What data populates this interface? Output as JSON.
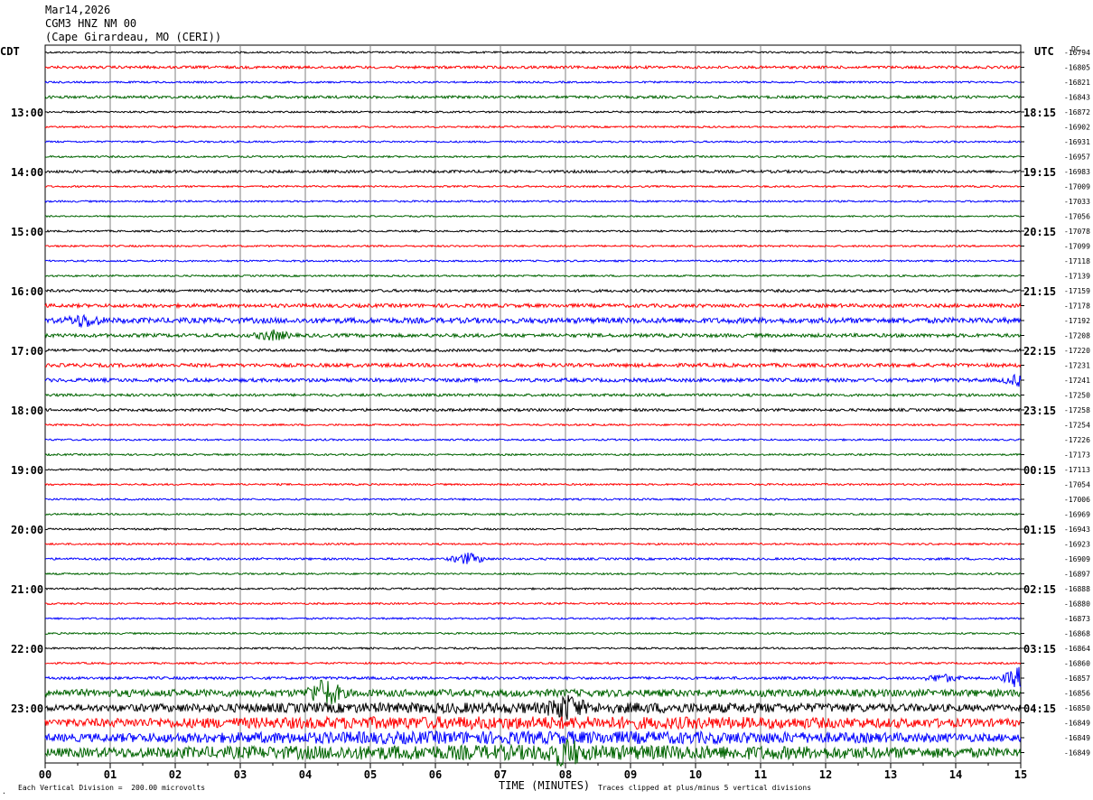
{
  "header": {
    "date": "Mar14,2026",
    "station": "CGM3 HNZ NM 00",
    "location": "(Cape Girardeau, MO (CERI))",
    "left_tz": "CDT",
    "right_tz": "UTC",
    "dc_label": "DC"
  },
  "footer": {
    "division_note": "Each Vertical Division =  200.00 microvolts",
    "x_title": "TIME (MINUTES)",
    "clip_note": "Traces clipped at plus/minus 5 vertical divisions"
  },
  "colors": {
    "black": "#000000",
    "red": "#ff0000",
    "blue": "#0000ff",
    "green": "#006400",
    "grid": "#808080"
  },
  "chart_data": {
    "type": "line",
    "title": "CGM3 HNZ NM 00",
    "xlabel": "TIME (MINUTES)",
    "xlim": [
      0,
      15
    ],
    "x_ticks": [
      "00",
      "01",
      "02",
      "03",
      "04",
      "05",
      "06",
      "07",
      "08",
      "09",
      "10",
      "11",
      "12",
      "13",
      "14",
      "15"
    ],
    "left_hour_labels": [
      {
        "row": 4,
        "label": "13:00"
      },
      {
        "row": 8,
        "label": "14:00"
      },
      {
        "row": 12,
        "label": "15:00"
      },
      {
        "row": 16,
        "label": "16:00"
      },
      {
        "row": 20,
        "label": "17:00"
      },
      {
        "row": 24,
        "label": "18:00"
      },
      {
        "row": 28,
        "label": "19:00"
      },
      {
        "row": 32,
        "label": "20:00"
      },
      {
        "row": 36,
        "label": "21:00"
      },
      {
        "row": 40,
        "label": "22:00"
      },
      {
        "row": 44,
        "label": "23:00"
      }
    ],
    "right_hour_labels": [
      {
        "row": 4,
        "label": "18:15"
      },
      {
        "row": 8,
        "label": "19:15"
      },
      {
        "row": 12,
        "label": "20:15"
      },
      {
        "row": 16,
        "label": "21:15"
      },
      {
        "row": 20,
        "label": "22:15"
      },
      {
        "row": 24,
        "label": "23:15"
      },
      {
        "row": 28,
        "label": "00:15"
      },
      {
        "row": 32,
        "label": "01:15"
      },
      {
        "row": 36,
        "label": "02:15"
      },
      {
        "row": 40,
        "label": "03:15"
      },
      {
        "row": 44,
        "label": "04:15"
      }
    ],
    "dc_offsets": [
      "-16794",
      "-16805",
      "-16821",
      "-16843",
      "-16872",
      "-16902",
      "-16931",
      "-16957",
      "-16983",
      "-17009",
      "-17033",
      "-17056",
      "-17078",
      "-17099",
      "-17118",
      "-17139",
      "-17159",
      "-17178",
      "-17192",
      "-17208",
      "-17220",
      "-17231",
      "-17241",
      "-17250",
      "-17258",
      "-17254",
      "-17226",
      "-17173",
      "-17113",
      "-17054",
      "-17006",
      "-16969",
      "-16943",
      "-16923",
      "-16909",
      "-16897",
      "-16888",
      "-16880",
      "-16873",
      "-16868",
      "-16864",
      "-16860",
      "-16857",
      "-16856",
      "-16850",
      "-16849",
      "-16849",
      "-16849"
    ],
    "trace_color_cycle": [
      "black",
      "red",
      "blue",
      "green"
    ],
    "trace_noise": [
      1,
      1.5,
      1,
      1.5,
      1,
      1,
      1,
      1,
      1.5,
      1,
      1,
      0.8,
      1,
      1,
      1,
      1,
      1.5,
      2,
      3,
      2,
      1.5,
      2,
      2,
      1.5,
      1.5,
      1,
      1,
      1,
      1,
      1,
      1,
      1,
      1,
      1,
      1.2,
      1,
      1,
      1,
      1,
      1,
      1,
      1,
      1.5,
      4,
      5,
      6,
      6,
      7
    ],
    "events": [
      {
        "row": 18,
        "minute": 0.6,
        "amp": 6
      },
      {
        "row": 19,
        "minute": 3.5,
        "amp": 5
      },
      {
        "row": 22,
        "minute": 15.0,
        "amp": 6
      },
      {
        "row": 34,
        "minute": 6.5,
        "amp": 6
      },
      {
        "row": 42,
        "minute": 13.8,
        "amp": 4
      },
      {
        "row": 42,
        "minute": 15.0,
        "amp": 12
      },
      {
        "row": 43,
        "minute": 4.3,
        "amp": 14
      },
      {
        "row": 44,
        "minute": 8.0,
        "amp": 10
      },
      {
        "row": 47,
        "minute": 8.0,
        "amp": 9
      }
    ]
  }
}
